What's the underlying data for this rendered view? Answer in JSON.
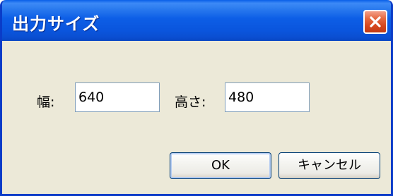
{
  "dialog": {
    "title": "出力サイズ"
  },
  "fields": {
    "width": {
      "label": "幅:",
      "value": "640"
    },
    "height": {
      "label": "高さ:",
      "value": "480"
    }
  },
  "buttons": {
    "ok_label": "OK",
    "cancel_label": "キャンセル"
  },
  "icons": {
    "close": "close-icon"
  },
  "colors": {
    "titlebar": "#0a5fe8",
    "close_button": "#d5461d",
    "dialog_background": "#ece9d8",
    "input_border": "#7f9db9"
  }
}
